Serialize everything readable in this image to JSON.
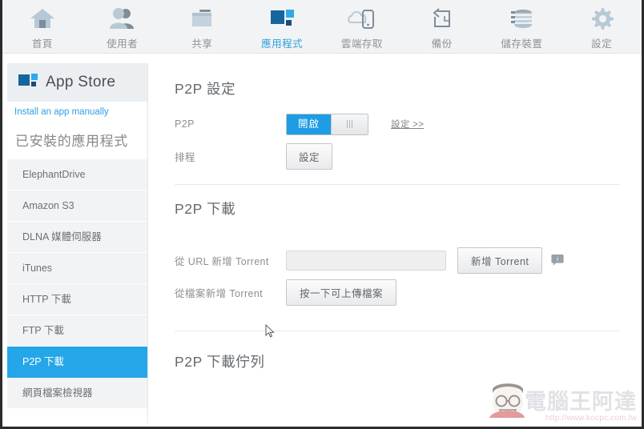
{
  "topnav": {
    "items": [
      {
        "label": "首頁",
        "icon": "home-icon",
        "active": false
      },
      {
        "label": "使用者",
        "icon": "users-icon",
        "active": false
      },
      {
        "label": "共享",
        "icon": "folder-share-icon",
        "active": false
      },
      {
        "label": "應用程式",
        "icon": "app-store-icon",
        "active": true
      },
      {
        "label": "雲端存取",
        "icon": "cloud-access-icon",
        "active": false
      },
      {
        "label": "備份",
        "icon": "backup-icon",
        "active": false
      },
      {
        "label": "儲存裝置",
        "icon": "storage-icon",
        "active": false
      },
      {
        "label": "設定",
        "icon": "gear-icon",
        "active": false
      }
    ]
  },
  "sidebar": {
    "app_store_title": "App Store",
    "app_store_icon": "app-store-icon",
    "manual_install_link": "Install an app manually",
    "installed_heading": "已安裝的應用程式",
    "apps": [
      {
        "label": "ElephantDrive",
        "active": false
      },
      {
        "label": "Amazon S3",
        "active": false
      },
      {
        "label": "DLNA 媒體伺服器",
        "active": false
      },
      {
        "label": "iTunes",
        "active": false
      },
      {
        "label": "HTTP 下載",
        "active": false
      },
      {
        "label": "FTP 下載",
        "active": false
      },
      {
        "label": "P2P 下載",
        "active": true
      },
      {
        "label": "網頁檔案檢視器",
        "active": false
      }
    ]
  },
  "main": {
    "settings_section": {
      "title": "P2P 設定",
      "p2p_row": {
        "label": "P2P",
        "toggle_state_label": "開啟",
        "settings_link": "設定 >>"
      },
      "schedule_row": {
        "label": "排程",
        "button_label": "設定"
      }
    },
    "download_section": {
      "title": "P2P 下載",
      "url_row": {
        "label": "從 URL 新增 Torrent",
        "input_value": "",
        "input_placeholder": "",
        "button_label": "新增 Torrent",
        "info_icon": "info-bubble-icon"
      },
      "file_row": {
        "label": "從檔案新增 Torrent",
        "button_label": "按一下可上傳檔案"
      }
    },
    "queue_section": {
      "title": "P2P 下載佇列"
    }
  },
  "watermark": {
    "brand": "電腦王阿達",
    "url": "http://www.kocpc.com.tw"
  },
  "colors": {
    "accent_blue": "#25a6e8",
    "toggle_blue": "#1e9ce4",
    "nav_bg": "#f2f3f4",
    "sidebar_item_bg": "#f2f3f4",
    "text_gray": "#6c7075"
  }
}
